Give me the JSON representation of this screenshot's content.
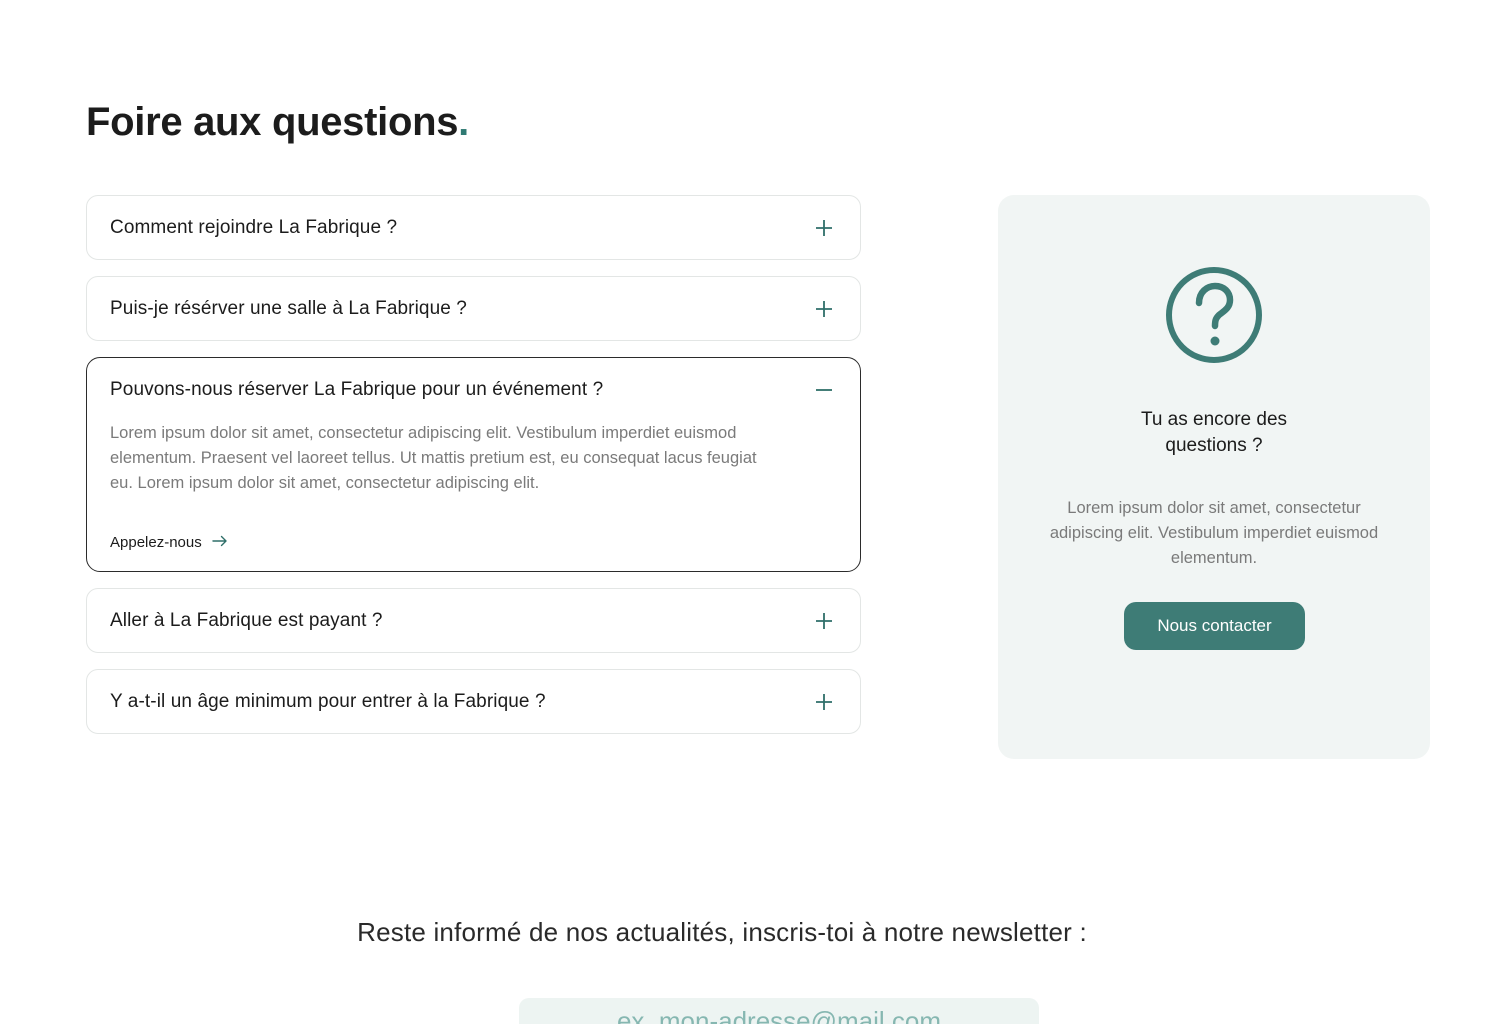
{
  "faq": {
    "title": "Foire aux questions",
    "title_dot": ".",
    "items": [
      {
        "question": "Comment rejoindre La Fabrique ?",
        "state": "collapsed"
      },
      {
        "question": "Puis-je résérver une salle à La Fabrique ?",
        "state": "collapsed"
      },
      {
        "question": "Pouvons-nous réserver La Fabrique pour un événement ?",
        "state": "expanded",
        "answer": "Lorem ipsum dolor sit amet, consectetur adipiscing elit. Vestibulum imperdiet euismod elementum. Praesent vel laoreet tellus. Ut mattis pretium est, eu consequat lacus feugiat eu. Lorem ipsum dolor sit amet, consectetur adipiscing elit.",
        "link_label": "Appelez-nous"
      },
      {
        "question": "Aller à La Fabrique est payant ?",
        "state": "collapsed"
      },
      {
        "question": "Y a-t-il un âge minimum pour entrer à la Fabrique ?",
        "state": "collapsed"
      }
    ]
  },
  "contact_card": {
    "icon": "question-circle-icon",
    "title": "Tu as encore des questions ?",
    "text": "Lorem ipsum dolor sit amet, consectetur adipiscing elit. Vestibulum imperdiet euismod elementum.",
    "button_label": "Nous contacter"
  },
  "newsletter": {
    "text": "Reste informé de nos actualités, inscris-toi à notre newsletter :",
    "placeholder": "ex. mon-adresse@mail.com"
  },
  "colors": {
    "accent": "#3e7c76",
    "card_bg": "#f1f5f4",
    "text": "#1c1c1c",
    "muted": "#7a7a7a"
  }
}
